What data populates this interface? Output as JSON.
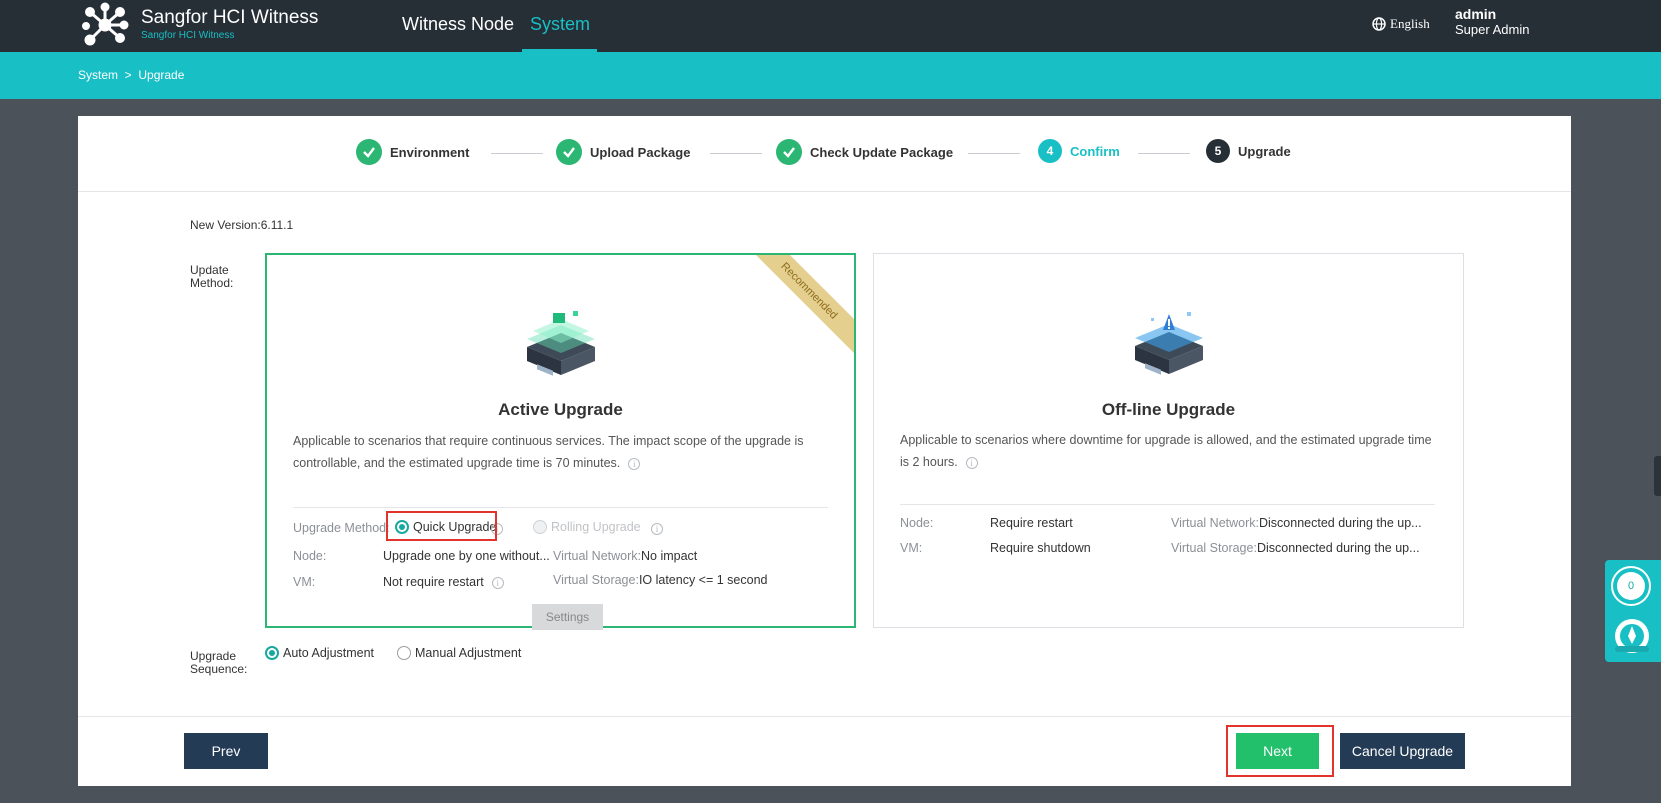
{
  "header": {
    "brand_title": "Sangfor HCI Witness",
    "brand_subtitle": "Sangfor HCI Witness",
    "nav": [
      "Witness Node",
      "System"
    ],
    "active_nav": "System",
    "language": "English",
    "user_name": "admin",
    "user_role": "Super Admin"
  },
  "breadcrumb": "System  >  Upgrade",
  "steps": [
    {
      "label": "Environment",
      "status": "done"
    },
    {
      "label": "Upload Package",
      "status": "done"
    },
    {
      "label": "Check Update Package",
      "status": "done"
    },
    {
      "label": "Confirm",
      "number": "4",
      "status": "current"
    },
    {
      "label": "Upgrade",
      "number": "5",
      "status": "todo"
    }
  ],
  "new_version": "New Version:6.11.1",
  "update_method_label": [
    "Update",
    "Method:"
  ],
  "active_card": {
    "ribbon": "Recommended",
    "title": "Active Upgrade",
    "description": "Applicable to scenarios that require continuous services. The impact scope of the upgrade is controllable, and the estimated upgrade time is 70 minutes.",
    "upgrade_method_label": "Upgrade Method:",
    "option_quick": "Quick Upgrade",
    "option_rolling": "Rolling Upgrade",
    "node_label": "Node:",
    "node_value": "Upgrade one by one without...",
    "vnet_label": "Virtual Network:",
    "vnet_value": "No impact",
    "vm_label": "VM:",
    "vm_value": "Not require restart",
    "vstorage_label": "Virtual Storage:",
    "vstorage_value": "IO latency <= 1 second"
  },
  "offline_card": {
    "title": "Off-line Upgrade",
    "description": "Applicable to scenarios where downtime for upgrade is allowed, and the estimated upgrade time is 2 hours.",
    "node_label": "Node:",
    "node_value": "Require restart",
    "vnet_label": "Virtual Network:",
    "vnet_value": "Disconnected during the up...",
    "vm_label": "VM:",
    "vm_value": "Require shutdown",
    "vstorage_label": "Virtual Storage:",
    "vstorage_value": "Disconnected during the up..."
  },
  "sequence": {
    "label": [
      "Upgrade",
      "Sequence:"
    ],
    "auto": "Auto Adjustment",
    "manual": "Manual Adjustment",
    "settings": "Settings"
  },
  "buttons": {
    "prev": "Prev",
    "next": "Next",
    "cancel": "Cancel Upgrade"
  },
  "widget": {
    "count": "0"
  },
  "colors": {
    "accent": "#18c0c6",
    "success": "#2bb673",
    "next_button": "#22c06a",
    "dark_button": "#243b55",
    "highlight": "#e2342c"
  }
}
